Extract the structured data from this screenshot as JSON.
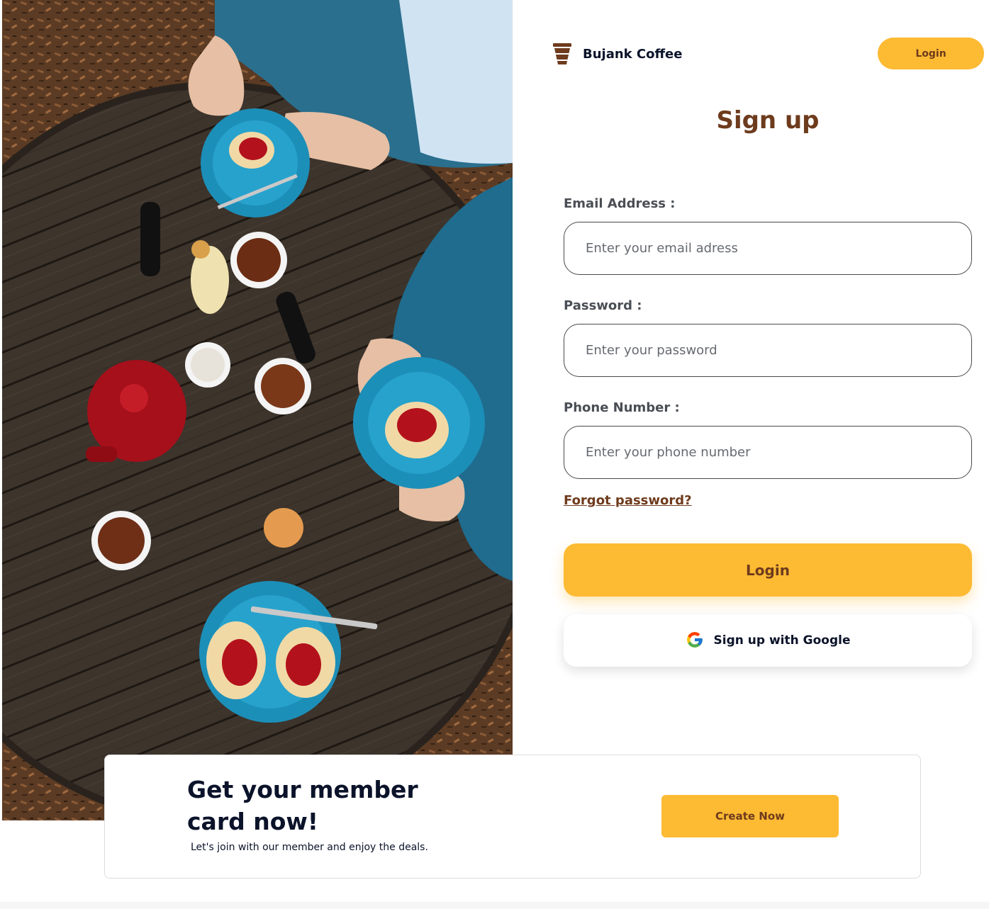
{
  "header": {
    "brand_name": "Bujank Coffee",
    "brand_icon": "coffee-cup-icon",
    "login_label": "Login"
  },
  "form": {
    "title": "Sign up",
    "email": {
      "label": "Email Address :",
      "placeholder": "Enter your email adress",
      "value": ""
    },
    "password": {
      "label": "Password :",
      "placeholder": "Enter your password",
      "value": ""
    },
    "phone": {
      "label": "Phone Number :",
      "placeholder": "Enter your phone number",
      "value": ""
    },
    "forgot_label": "Forgot password?",
    "login_label": "Login",
    "google_label": "Sign up with Google",
    "google_icon": "google-icon"
  },
  "member": {
    "title": "Get your member card now!",
    "subtitle": "Let's join with our member and enjoy the deals.",
    "cta_label": "Create Now"
  },
  "colors": {
    "accent": "#fdba33",
    "brand_brown": "#6e3b1d",
    "text_dark": "#0b132a"
  }
}
